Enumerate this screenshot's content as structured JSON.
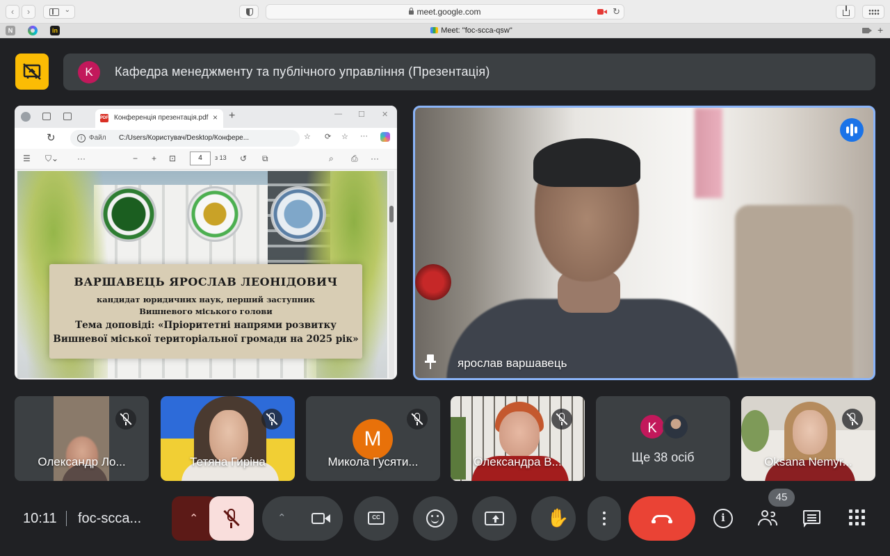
{
  "browser": {
    "url": "meet.google.com",
    "tab_title": "Meet: \"foc-scca-qsw\"",
    "pinned_favicons": [
      "N",
      "C",
      "in"
    ]
  },
  "meet": {
    "presentation_banner": {
      "avatar_letter": "K",
      "title": "Кафедра менеджменту та публічного управління (Презентація)"
    },
    "shared_screen": {
      "tab_title": "Конференція презентація.pdf",
      "file_label": "Файл",
      "path": "C:/Users/Користувач/Desktop/Конфере...",
      "page_current": "4",
      "page_total": "з 13",
      "pdf_icon_text": "PDF",
      "slide": {
        "name": "ВАРШАВЕЦЬ ЯРОСЛАВ ЛЕОНІДОВИЧ",
        "line2": "кандидат юридичних наук, перший заступник",
        "line3": "Вишневого міського голови",
        "line4": "Тема доповіді: «Пріоритетні напрями розвитку",
        "line5": "Вишневої міської територіальної громади на 2025 рік»"
      }
    },
    "speaker": {
      "name": "ярослав варшавець"
    },
    "participants": [
      {
        "name": "Олександр Ло..."
      },
      {
        "name": "Тетяна Гиріна"
      },
      {
        "name": "Микола Гусяти...",
        "avatar_letter": "M"
      },
      {
        "name": "Олександра В..."
      },
      {
        "more_label": "Ще 38 осіб",
        "avatar_letter": "K"
      },
      {
        "name": "Oksana Nemyr..."
      }
    ],
    "bottom_bar": {
      "time": "10:11",
      "meeting_code": "foc-scca...",
      "people_count": "45"
    }
  },
  "colors": {
    "background": "#202124",
    "tile": "#3c4043",
    "accent_blue": "#8ab4f8",
    "leave_red": "#ea4335",
    "mic_off_bg": "#f9dedc",
    "present_lock_yellow": "#fbbc04"
  }
}
